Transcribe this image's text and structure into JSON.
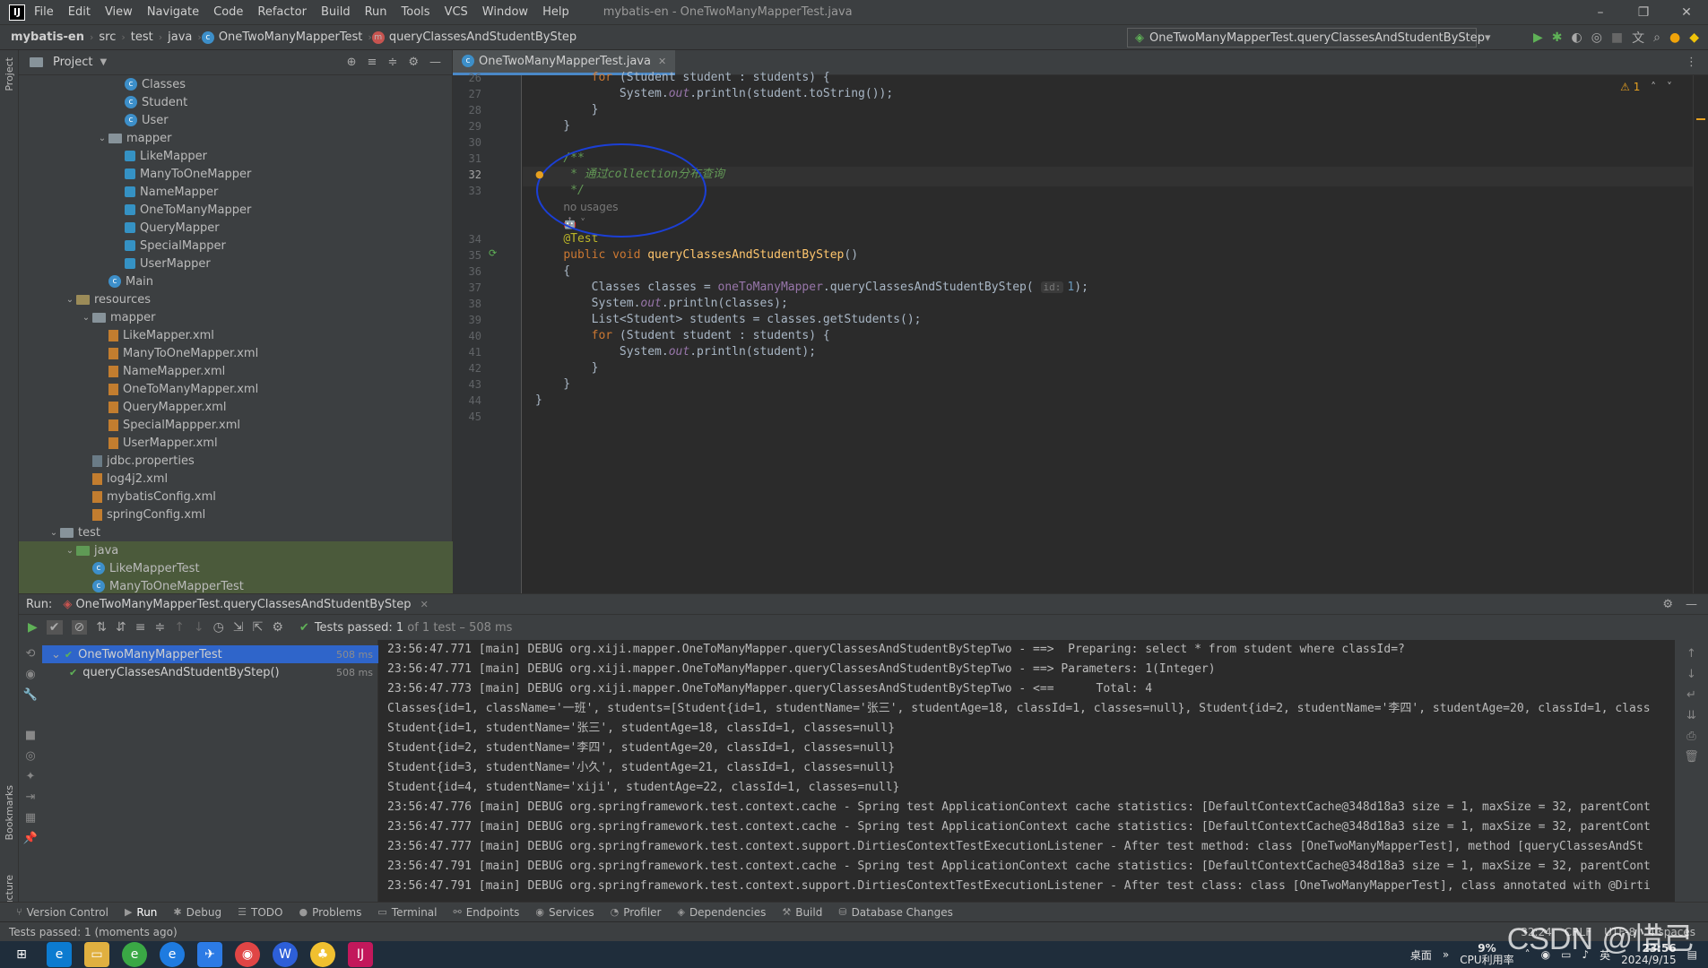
{
  "window": {
    "menus": [
      "File",
      "Edit",
      "View",
      "Navigate",
      "Code",
      "Refactor",
      "Build",
      "Run",
      "Tools",
      "VCS",
      "Window",
      "Help"
    ],
    "title": "mybatis-en - OneTwoManyMapperTest.java"
  },
  "navbar": {
    "project": "mybatis-en",
    "crumbs": [
      "src",
      "test",
      "java",
      "OneTwoManyMapperTest",
      "queryClassesAndStudentByStep"
    ],
    "run_config": "OneTwoManyMapperTest.queryClassesAndStudentByStep"
  },
  "project_panel": {
    "title": "Project",
    "nodes": [
      {
        "label": "Classes",
        "icon": "class-icon",
        "indent": 5
      },
      {
        "label": "Student",
        "icon": "class-icon",
        "indent": 5
      },
      {
        "label": "User",
        "icon": "class-icon",
        "indent": 5
      },
      {
        "label": "mapper",
        "icon": "folder-icon",
        "indent": 4,
        "arrow": "v"
      },
      {
        "label": "LikeMapper",
        "icon": "interface-icon",
        "indent": 5
      },
      {
        "label": "ManyToOneMapper",
        "icon": "interface-icon",
        "indent": 5
      },
      {
        "label": "NameMapper",
        "icon": "interface-icon",
        "indent": 5
      },
      {
        "label": "OneToManyMapper",
        "icon": "interface-icon",
        "indent": 5
      },
      {
        "label": "QueryMapper",
        "icon": "interface-icon",
        "indent": 5
      },
      {
        "label": "SpecialMapper",
        "icon": "interface-icon",
        "indent": 5
      },
      {
        "label": "UserMapper",
        "icon": "interface-icon",
        "indent": 5
      },
      {
        "label": "Main",
        "icon": "class-icon",
        "indent": 4
      },
      {
        "label": "resources",
        "icon": "resources-folder-icon",
        "indent": 2,
        "arrow": "v"
      },
      {
        "label": "mapper",
        "icon": "folder-icon",
        "indent": 3,
        "arrow": "v"
      },
      {
        "label": "LikeMapper.xml",
        "icon": "xml-icon",
        "indent": 4
      },
      {
        "label": "ManyToOneMapper.xml",
        "icon": "xml-icon",
        "indent": 4
      },
      {
        "label": "NameMapper.xml",
        "icon": "xml-icon",
        "indent": 4
      },
      {
        "label": "OneToManyMapper.xml",
        "icon": "xml-icon",
        "indent": 4
      },
      {
        "label": "QueryMapper.xml",
        "icon": "xml-icon",
        "indent": 4
      },
      {
        "label": "SpecialMappper.xml",
        "icon": "xml-icon",
        "indent": 4
      },
      {
        "label": "UserMapper.xml",
        "icon": "xml-icon",
        "indent": 4
      },
      {
        "label": "jdbc.properties",
        "icon": "properties-icon",
        "indent": 3
      },
      {
        "label": "log4j2.xml",
        "icon": "xml-icon",
        "indent": 3
      },
      {
        "label": "mybatisConfig.xml",
        "icon": "xml-icon",
        "indent": 3
      },
      {
        "label": "springConfig.xml",
        "icon": "xml-icon",
        "indent": 3
      },
      {
        "label": "test",
        "icon": "folder-icon",
        "indent": 1,
        "arrow": "v"
      },
      {
        "label": "java",
        "icon": "test-folder-icon",
        "indent": 2,
        "arrow": "v"
      },
      {
        "label": "LikeMapperTest",
        "icon": "test-class-icon",
        "indent": 3
      },
      {
        "label": "ManyToOneMapperTest",
        "icon": "test-class-icon",
        "indent": 3
      }
    ]
  },
  "editor": {
    "tab": "OneTwoManyMapperTest.java",
    "warnings": "1",
    "lines": [
      {
        "n": "26",
        "html": "        <span class='kw'>for</span> (Student student : students) {"
      },
      {
        "n": "27",
        "html": "            System.<span class='fld'>out</span>.println(student.toString());"
      },
      {
        "n": "28",
        "html": "        }"
      },
      {
        "n": "29",
        "html": "    }"
      },
      {
        "n": "30",
        "html": ""
      },
      {
        "n": "31",
        "html": "    <span class='cm'>/**</span>"
      },
      {
        "n": "32",
        "html": "     <span class='cm'>* 通过collection分布查询</span>",
        "current": true
      },
      {
        "n": "33",
        "html": "     <span class='cm'>*/</span>"
      },
      {
        "n": "",
        "html": "    <span class='inlay'>no usages</span>"
      },
      {
        "n": "",
        "html": "    <span class='inlay'>🤖 ˅</span>"
      },
      {
        "n": "34",
        "html": "    <span class='ann'>@Test</span>"
      },
      {
        "n": "35",
        "html": "    <span class='kw'>public void</span> <span class='fn'>queryClassesAndStudentByStep</span>()"
      },
      {
        "n": "36",
        "html": "    {"
      },
      {
        "n": "37",
        "html": "        Classes classes = <span class='fld' style='font-style:normal'>oneToManyMapper</span>.queryClassesAndStudentByStep( <span class='hint'>id:</span><span class='num'>1</span>);"
      },
      {
        "n": "38",
        "html": "        System.<span class='fld'>out</span>.println(classes);"
      },
      {
        "n": "39",
        "html": "        List&lt;Student&gt; students = classes.getStudents();"
      },
      {
        "n": "40",
        "html": "        <span class='kw'>for</span> (Student student : students) {"
      },
      {
        "n": "41",
        "html": "            System.<span class='fld'>out</span>.println(student);"
      },
      {
        "n": "42",
        "html": "        }"
      },
      {
        "n": "43",
        "html": "    }"
      },
      {
        "n": "44",
        "html": "}"
      },
      {
        "n": "45",
        "html": ""
      }
    ]
  },
  "run": {
    "label": "Run:",
    "tab": "OneTwoManyMapperTest.queryClassesAndStudentByStep",
    "status_prefix": "Tests passed: ",
    "status_count": "1",
    "status_suffix": " of 1 test – 508 ms",
    "tests": [
      {
        "label": "OneTwoManyMapperTest",
        "time": "508 ms",
        "selected": true
      },
      {
        "label": "queryClassesAndStudentByStep()",
        "time": "508 ms"
      }
    ],
    "console": [
      "23:56:47.771 [main] DEBUG org.xiji.mapper.OneToManyMapper.queryClassesAndStudentByStepTwo - ==>  Preparing: select * from student where classId=?",
      "23:56:47.771 [main] DEBUG org.xiji.mapper.OneToManyMapper.queryClassesAndStudentByStepTwo - ==> Parameters: 1(Integer)",
      "23:56:47.773 [main] DEBUG org.xiji.mapper.OneToManyMapper.queryClassesAndStudentByStepTwo - <==      Total: 4",
      "Classes{id=1, className='一班', students=[Student{id=1, studentName='张三', studentAge=18, classId=1, classes=null}, Student{id=2, studentName='李四', studentAge=20, classId=1, class",
      "Student{id=1, studentName='张三', studentAge=18, classId=1, classes=null}",
      "Student{id=2, studentName='李四', studentAge=20, classId=1, classes=null}",
      "Student{id=3, studentName='小久', studentAge=21, classId=1, classes=null}",
      "Student{id=4, studentName='xiji', studentAge=22, classId=1, classes=null}",
      "23:56:47.776 [main] DEBUG org.springframework.test.context.cache - Spring test ApplicationContext cache statistics: [DefaultContextCache@348d18a3 size = 1, maxSize = 32, parentCont",
      "23:56:47.777 [main] DEBUG org.springframework.test.context.cache - Spring test ApplicationContext cache statistics: [DefaultContextCache@348d18a3 size = 1, maxSize = 32, parentCont",
      "23:56:47.777 [main] DEBUG org.springframework.test.context.support.DirtiesContextTestExecutionListener - After test method: class [OneTwoManyMapperTest], method [queryClassesAndSt",
      "23:56:47.791 [main] DEBUG org.springframework.test.context.cache - Spring test ApplicationContext cache statistics: [DefaultContextCache@348d18a3 size = 1, maxSize = 32, parentCont",
      "23:56:47.791 [main] DEBUG org.springframework.test.context.support.DirtiesContextTestExecutionListener - After test class: class [OneTwoManyMapperTest], class annotated with @Dirti"
    ]
  },
  "toolstrip": [
    {
      "label": "Version Control",
      "icon": "vcs-icon"
    },
    {
      "label": "Run",
      "icon": "run-icon",
      "active": true
    },
    {
      "label": "Debug",
      "icon": "debug-icon"
    },
    {
      "label": "TODO",
      "icon": "todo-icon"
    },
    {
      "label": "Problems",
      "icon": "problems-icon"
    },
    {
      "label": "Terminal",
      "icon": "terminal-icon"
    },
    {
      "label": "Endpoints",
      "icon": "endpoints-icon"
    },
    {
      "label": "Services",
      "icon": "services-icon"
    },
    {
      "label": "Profiler",
      "icon": "profiler-icon"
    },
    {
      "label": "Dependencies",
      "icon": "dependencies-icon"
    },
    {
      "label": "Build",
      "icon": "build-icon"
    },
    {
      "label": "Database Changes",
      "icon": "database-icon"
    }
  ],
  "statusbar": {
    "left": "Tests passed: 1 (moments ago)",
    "position": "32:24",
    "line_sep": "CRLF",
    "encoding": "UTF-8",
    "indent": "4 spaces"
  },
  "sidebars": {
    "left_top": "Project",
    "bookmarks": "Bookmarks",
    "structure": "Structure"
  },
  "taskbar": {
    "desktop": "桌面",
    "cpu_pct": "9%",
    "cpu_label": "CPU利用率",
    "ime": "英",
    "time": "23:56",
    "date": "2024/9/15"
  },
  "watermark": "CSDN @惜己"
}
